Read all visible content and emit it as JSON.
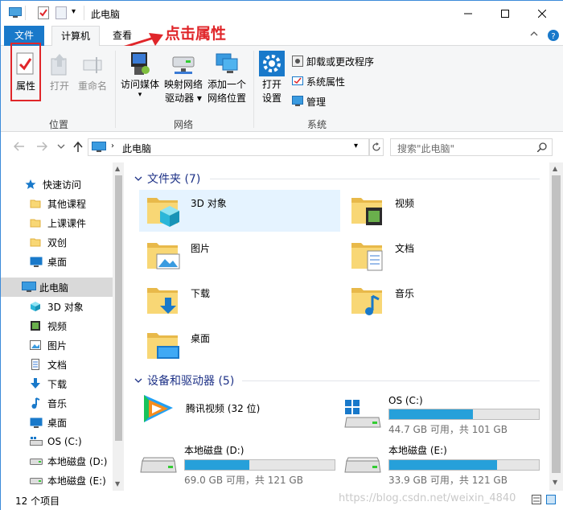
{
  "window": {
    "title": "此电脑"
  },
  "tabs": {
    "file": "文件",
    "computer": "计算机",
    "view": "查看"
  },
  "ribbon": {
    "location": {
      "label": "位置",
      "properties": "属性",
      "open": "打开",
      "rename": "重命名"
    },
    "network": {
      "label": "网络",
      "media": "访问媒体",
      "map_drive_1": "映射网络",
      "map_drive_2": "驱动器",
      "add_loc_1": "添加一个",
      "add_loc_2": "网络位置"
    },
    "system": {
      "label": "系统",
      "settings_1": "打开",
      "settings_2": "设置",
      "uninstall": "卸载或更改程序",
      "sys_props": "系统属性",
      "manage": "管理"
    }
  },
  "annotation": {
    "text": "点击属性"
  },
  "address": {
    "path": "此电脑",
    "search_placeholder": "搜索\"此电脑\""
  },
  "nav": {
    "quick_access": "快速访问",
    "pinned": [
      "其他课程",
      "上课课件",
      "双创",
      "桌面"
    ],
    "this_pc": "此电脑",
    "pc_items": [
      "3D 对象",
      "视频",
      "图片",
      "文档",
      "下载",
      "音乐",
      "桌面",
      "OS (C:)",
      "本地磁盘 (D:)",
      "本地磁盘 (E:)"
    ]
  },
  "content": {
    "folders_header": "文件夹 (7)",
    "folders": [
      "3D 对象",
      "视频",
      "图片",
      "文档",
      "下载",
      "音乐",
      "桌面"
    ],
    "devices_header": "设备和驱动器 (5)",
    "tencent": "腾讯视频 (32 位)",
    "drives": [
      {
        "name": "OS (C:)",
        "free": "44.7 GB 可用，共 101 GB",
        "used_fraction": 0.56
      },
      {
        "name": "本地磁盘 (D:)",
        "free": "69.0 GB 可用，共 121 GB",
        "used_fraction": 0.43
      },
      {
        "name": "本地磁盘 (E:)",
        "free": "33.9 GB 可用，共 121 GB",
        "used_fraction": 0.72
      }
    ]
  },
  "status": {
    "count": "12 个项目",
    "watermark": "https://blog.csdn.net/weixin_4840"
  },
  "colors": {
    "accent": "#1979ca",
    "annotation": "#e0262a",
    "drive_fill": "#26a0da"
  }
}
